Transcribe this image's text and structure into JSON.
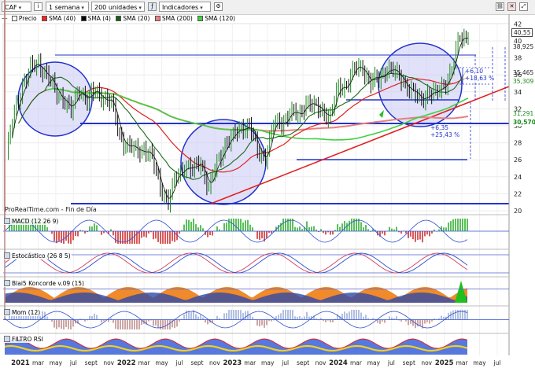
{
  "toolbar": {
    "symbol": "CAF",
    "interval": "1 semana",
    "units": "200 unidades",
    "indicators": "Indicadores"
  },
  "legend": [
    {
      "label": "Precio",
      "color": "#ffffff"
    },
    {
      "label": "SMA (40)",
      "color": "#ff2020"
    },
    {
      "label": "SMA (4)",
      "color": "#000000"
    },
    {
      "label": "SMA (20)",
      "color": "#1a5a1a"
    },
    {
      "label": "SMA (200)",
      "color": "#f08080"
    },
    {
      "label": "SMA (120)",
      "color": "#40d040"
    }
  ],
  "brand": "ProRealTime.com - Fin de Día",
  "panels": {
    "macd": "MACD (12 26 9)",
    "stoch": "Estocástico (26 8 5)",
    "blai": "Blai5 Koncorde v.09 (15)",
    "mom": "Mom (12)",
    "rsi": "FILTRO RSI"
  },
  "chart_data": {
    "type": "line",
    "ylim": [
      20,
      43
    ],
    "yticks": [
      "42",
      "40",
      "38",
      "36",
      "34",
      "32",
      "30",
      "28",
      "26",
      "24",
      "22",
      "20"
    ],
    "xticks": [
      "2021",
      "mar",
      "may",
      "jul",
      "sept",
      "nov",
      "2022",
      "mar",
      "may",
      "jul",
      "sept",
      "nov",
      "2023",
      "mar",
      "may",
      "jul",
      "sept",
      "nov",
      "2024",
      "mar",
      "may",
      "jul",
      "sept",
      "nov",
      "2025",
      "mar",
      "may",
      "jul"
    ],
    "price_tags": [
      {
        "text": "40,55",
        "value": 40.55,
        "color": "#ffffff"
      },
      {
        "text": "38,925",
        "value": 38.925,
        "color": "#ffffff"
      },
      {
        "text": "35,465",
        "value": 35.465,
        "color": "#ffffff"
      },
      {
        "text": "35,309",
        "value": 35.309,
        "color": "#ffffff"
      },
      {
        "text": "31,291",
        "value": 31.291,
        "color": "#ffffff"
      },
      {
        "text": "30,570",
        "value": 30.57,
        "color": "#ffffff"
      }
    ],
    "annotations": [
      "+6,10",
      "+18,63 %",
      "+6,35",
      "+25,43 %"
    ],
    "series": [
      {
        "name": "Precio",
        "type": "ohlc",
        "weeks": [
          0,
          4,
          8,
          12,
          16,
          20,
          24,
          28,
          32,
          36,
          40,
          44,
          48,
          52,
          56,
          60,
          64,
          68,
          72,
          76,
          80,
          84,
          88,
          92,
          96,
          100,
          104,
          108,
          112,
          116,
          120,
          124,
          128,
          132,
          136,
          140,
          144,
          148,
          152,
          156,
          160,
          164,
          168,
          172,
          176,
          180,
          184,
          188,
          192,
          196,
          200,
          204,
          208,
          212,
          216,
          220,
          224,
          228
        ],
        "values": [
          26.5,
          31.5,
          35,
          36.5,
          37.5,
          36,
          34,
          33.5,
          31.5,
          34.5,
          33,
          34,
          33.5,
          32.5,
          29,
          27.5,
          27,
          27.5,
          26,
          23,
          21,
          24,
          25.5,
          24.5,
          26,
          22.5,
          25.5,
          28,
          28.5,
          30,
          30,
          27,
          26.5,
          30,
          30.5,
          31.5,
          31,
          33,
          32,
          32,
          31,
          34.5,
          35,
          36.5,
          37,
          35,
          35.5,
          37,
          36,
          35.5,
          34,
          33,
          34,
          33.5,
          35,
          36.5,
          40.5,
          40.55
        ]
      }
    ]
  }
}
